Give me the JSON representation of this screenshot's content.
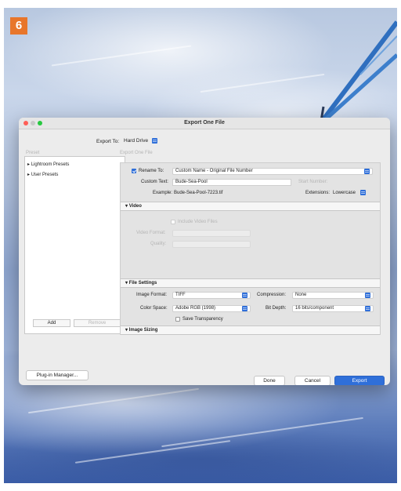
{
  "step_number": "6",
  "dialog": {
    "title": "Export One File",
    "export_to_label": "Export To:",
    "export_to_value": "Hard Drive",
    "preset_header": "Preset",
    "section_header": "Export One File",
    "presets": [
      "Lightroom Presets",
      "User Presets"
    ],
    "add_label": "Add",
    "remove_label": "Remove",
    "plugin_manager_label": "Plug-in Manager...",
    "done_label": "Done",
    "cancel_label": "Cancel",
    "export_label": "Export"
  },
  "file_naming": {
    "rename_label": "Rename To:",
    "rename_value": "Custom Name - Original File Number",
    "custom_text_label": "Custom Text:",
    "custom_text_value": "Bude-Sea-Pool",
    "start_number_label": "Start Number:",
    "example_label": "Example:",
    "example_value": "Bude-Sea-Pool-7223.tif",
    "extensions_label": "Extensions:",
    "extensions_value": "Lowercase"
  },
  "video": {
    "header": "Video",
    "include_label": "Include Video Files",
    "format_label": "Video Format:",
    "quality_label": "Quality:"
  },
  "file_settings": {
    "header": "File Settings",
    "format_label": "Image Format:",
    "format_value": "TIFF",
    "compression_label": "Compression:",
    "compression_value": "None",
    "color_space_label": "Color Space:",
    "color_space_value": "Adobe RGB (1998)",
    "bit_depth_label": "Bit Depth:",
    "bit_depth_value": "16 bits/component",
    "transparency_label": "Save Transparency"
  },
  "image_sizing": {
    "header": "Image Sizing"
  },
  "colors": {
    "accent": "#2f6fd9",
    "badge": "#e8762b"
  }
}
